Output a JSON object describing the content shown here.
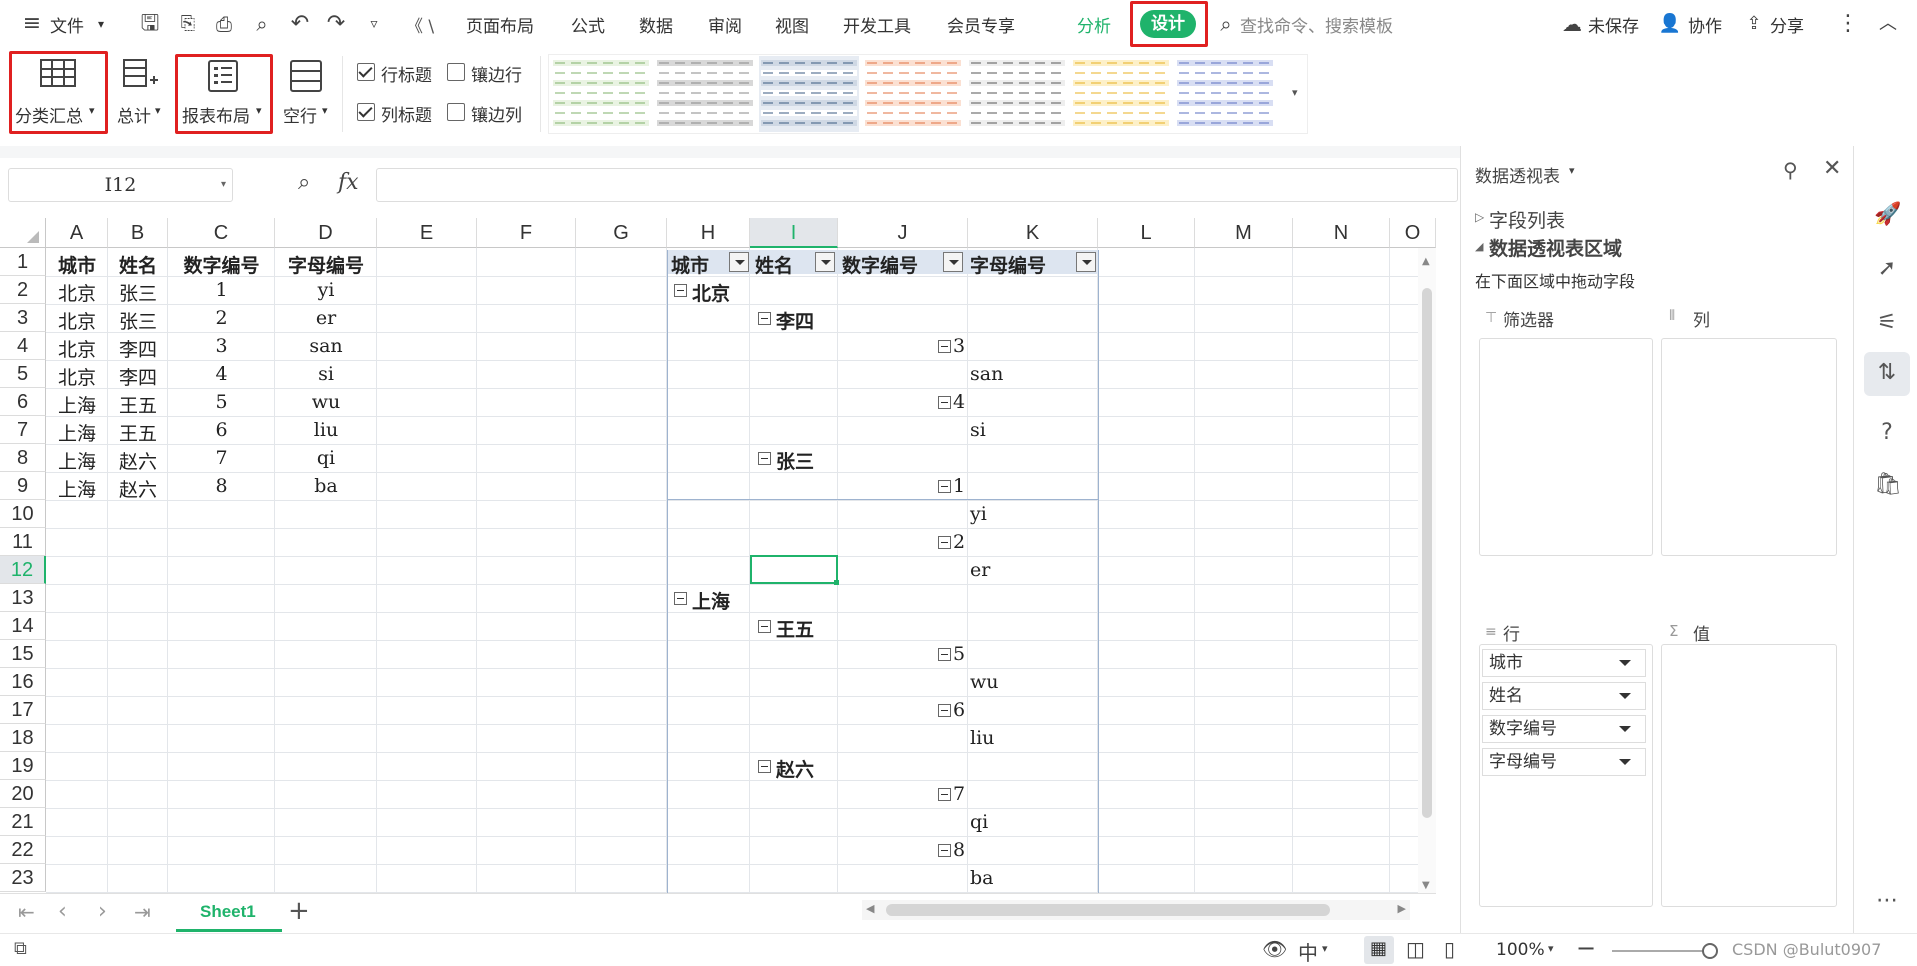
{
  "menu": {
    "file": "文件",
    "truncated": "《 \\",
    "items": [
      "页面布局",
      "公式",
      "数据",
      "审阅",
      "视图",
      "开发工具",
      "会员专享"
    ],
    "analyze": "分析",
    "design": "设计",
    "search_placeholder": "查找命令、搜索模板",
    "unsaved": "未保存",
    "collab": "协作",
    "share": "分享"
  },
  "ribbon": {
    "subtotal": "分类汇总",
    "total": "总计",
    "report_layout": "报表布局",
    "blank_row": "空行",
    "row_header": "行标题",
    "banded_rows": "镶边行",
    "col_header": "列标题",
    "banded_cols": "镶边列"
  },
  "formula": {
    "name_box": "I12",
    "fx": "fx"
  },
  "columns": [
    "A",
    "B",
    "C",
    "D",
    "E",
    "F",
    "G",
    "H",
    "I",
    "J",
    "K",
    "L",
    "M",
    "N",
    "O"
  ],
  "rows": [
    "1",
    "2",
    "3",
    "4",
    "5",
    "6",
    "7",
    "8",
    "9",
    "10",
    "11",
    "12",
    "13",
    "14",
    "15",
    "16",
    "17",
    "18",
    "19",
    "20",
    "21",
    "22",
    "23"
  ],
  "source_table": {
    "headers": [
      "城市",
      "姓名",
      "数字编号",
      "字母编号"
    ],
    "rows": [
      [
        "北京",
        "张三",
        "1",
        "yi"
      ],
      [
        "北京",
        "张三",
        "2",
        "er"
      ],
      [
        "北京",
        "李四",
        "3",
        "san"
      ],
      [
        "北京",
        "李四",
        "4",
        "si"
      ],
      [
        "上海",
        "王五",
        "5",
        "wu"
      ],
      [
        "上海",
        "王五",
        "6",
        "liu"
      ],
      [
        "上海",
        "赵六",
        "7",
        "qi"
      ],
      [
        "上海",
        "赵六",
        "8",
        "ba"
      ]
    ]
  },
  "pivot": {
    "headers": [
      "城市",
      "姓名",
      "数字编号",
      "字母编号"
    ],
    "city1": "北京",
    "name_li": "李四",
    "n3": "3",
    "l3": "san",
    "n4": "4",
    "l4": "si",
    "name_zhang": "张三",
    "n1": "1",
    "l1": "yi",
    "n2": "2",
    "l2": "er",
    "city2": "上海",
    "name_wang": "王五",
    "n5": "5",
    "l5": "wu",
    "n6": "6",
    "l6": "liu",
    "name_zhao": "赵六",
    "n7": "7",
    "l7": "qi",
    "n8": "8",
    "l8": "ba"
  },
  "sheet": {
    "tab": "Sheet1",
    "add": "+"
  },
  "status": {
    "zoom": "100%",
    "watermark": "CSDN @Bulut0907"
  },
  "panel": {
    "title": "数据透视表",
    "field_list": "字段列表",
    "area_title": "数据透视表区域",
    "hint": "在下面区域中拖动字段",
    "filter": "筛选器",
    "col": "列",
    "row": "行",
    "value": "值",
    "row_fields": [
      "城市",
      "姓名",
      "数字编号",
      "字母编号"
    ]
  },
  "colors": {
    "accent_green": "#1fb36b",
    "highlight_red": "#e02020",
    "pivot_header": "#dde5f0"
  }
}
